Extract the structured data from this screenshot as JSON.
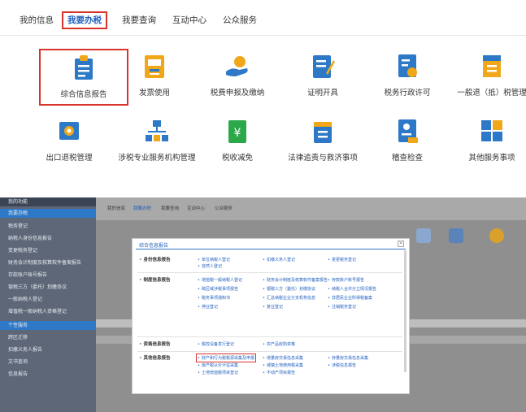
{
  "top_nav": {
    "tabs": [
      {
        "label": "我的信息"
      },
      {
        "label": "我要办税"
      },
      {
        "label": "我要查询"
      },
      {
        "label": "互动中心"
      },
      {
        "label": "公众服务"
      }
    ],
    "active_index": 1
  },
  "services": [
    {
      "label": "综合信息报告",
      "icon": "report-icon",
      "color": "#2d79c7"
    },
    {
      "label": "发票使用",
      "icon": "invoice-icon",
      "color": "#f0a81a"
    },
    {
      "label": "税费申报及缴纳",
      "icon": "tax-payment-icon",
      "color": "#2d79c7"
    },
    {
      "label": "证明开具",
      "icon": "certificate-icon",
      "color": "#2d79c7"
    },
    {
      "label": "税务行政许可",
      "icon": "license-icon",
      "color": "#2d79c7"
    },
    {
      "label": "一般退（抵）税管理",
      "icon": "refund-icon",
      "color": "#f0a81a"
    },
    {
      "label": "出口退税管理",
      "icon": "export-refund-icon",
      "color": "#2d79c7"
    },
    {
      "label": "涉税专业服务机构管理",
      "icon": "org-chart-icon",
      "color": "#2d79c7"
    },
    {
      "label": "税收减免",
      "icon": "tax-relief-icon",
      "color": "#2aa84a"
    },
    {
      "label": "法律追责与救济事项",
      "icon": "legal-icon",
      "color": "#2d79c7"
    },
    {
      "label": "稽查检查",
      "icon": "inspection-icon",
      "color": "#2d79c7"
    },
    {
      "label": "其他服务事项",
      "icon": "grid-icon",
      "color": "#2d79c7"
    }
  ],
  "screenshot": {
    "sidebar_items": [
      "我的功能",
      "我要办税",
      "税务登记",
      "纳税人身份信息报告",
      "变更税务登记",
      "财务会计制度及核算软件备案报告",
      "存款账户账号报告",
      "银税三方（委托）划缴协议",
      "一般纳税人登记",
      "增值税一般纳税人资格登记",
      "个性服务",
      "跨区迁移",
      "扣缴义务人报告",
      "文书查询",
      "信息报告"
    ],
    "top_tabs": [
      "我的信息",
      "我要办税",
      "我要查询",
      "互动中心",
      "公众服务"
    ],
    "modal": {
      "title": "综合信息报告",
      "sections": [
        {
          "label": "身份信息报告",
          "links": [
            "单位纳税人登记",
            "自然人登记",
            "扣缴义务人登记",
            "变更税务登记",
            "个体工商户登记"
          ]
        },
        {
          "label": "制度信息报告",
          "links": [
            "增值税一般纳税人登记",
            "财务会计制度及核算软件备案报告",
            "存款账户账号报告",
            "跨区域涉税事项报告",
            "银税三方（委托）划缴协议",
            "纳税人合并分立情况报告",
            "税务事项通知书",
            "汇总纳税企业分支机构信息",
            "非居民企业所得税备案",
            "停业登记",
            "复业登记",
            "注销税务登记"
          ]
        },
        {
          "label": "资格信息报告",
          "links": [
            "税控设备发行登记",
            "农产品收购资格"
          ]
        },
        {
          "label": "其他信息报告",
          "links": [
            "财产和行为税税源采集及申报",
            "增量房交易信息采集",
            "土地增值税项目登记",
            "存量房交易信息采集",
            "房产税从价计征采集",
            "城镇土地使用税采集",
            "涉税信息报告",
            "不动产项目报告"
          ]
        }
      ]
    }
  }
}
